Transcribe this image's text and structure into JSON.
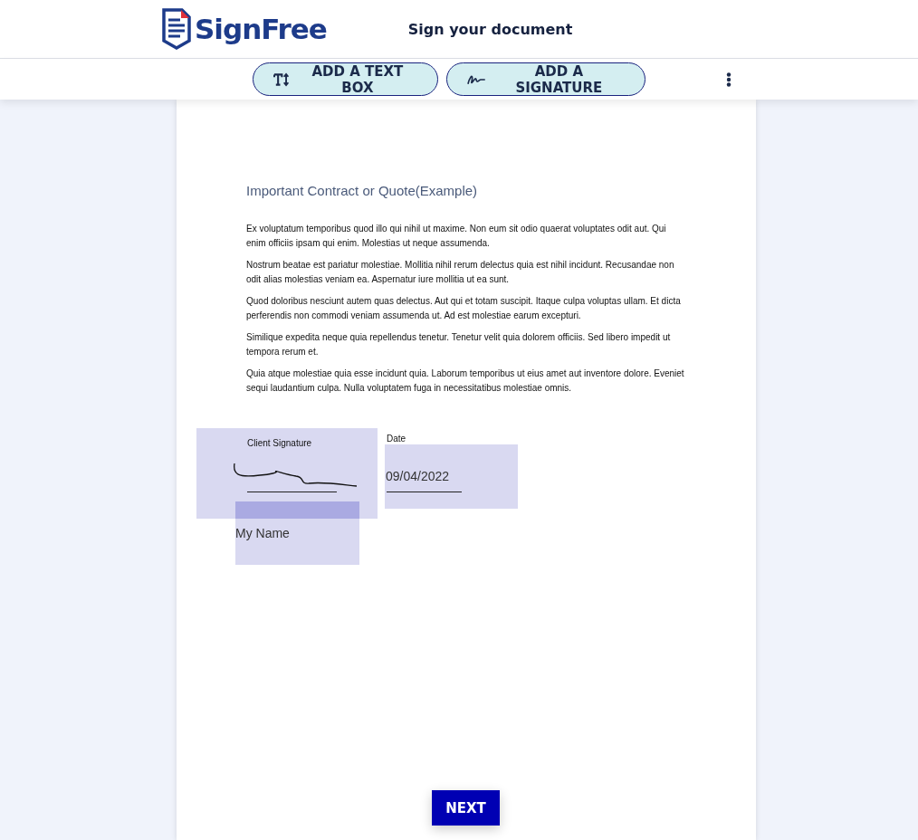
{
  "header": {
    "logo": "SignFree",
    "title": "Sign your document"
  },
  "toolbar": {
    "buttons": [
      {
        "label": "ADD A TEXT BOX",
        "kind": "text"
      },
      {
        "label": "ADD A SIGNATURE",
        "kind": "signature"
      }
    ]
  },
  "document": {
    "title": "Important Contract or Quote(Example)",
    "paragraphs": [
      "Ex voluptatum temporibus quod illo qui nihil ut maxime. Non eum sit odio quaerat voluptates odit aut. Qui enim officiis ipsam qui enim. Molestias ut neque assumenda.",
      "Nostrum beatae est pariatur molestiae. Mollitia nihil rerum delectus quia est nihil incidunt. Recusandae non odit alias molestias veniam ea. Aspernatur iure mollitia ut ea sunt.",
      "Quod doloribus nesciunt autem quas delectus. Aut qui et totam suscipit. Itaque culpa voluptas ullam. Et dicta perferendis non commodi veniam assumenda ut. Ad est molestiae earum excepturi.",
      "Similique expedita neque quia repellendus tenetur. Tenetur velit quia dolorem officiis. Sed libero impedit ut tempora rerum et.",
      "Quia atque molestiae quia esse incidunt quia. Laborum temporibus ut eius amet aut inventore dolore. Eveniet sequi laudantium culpa. Nulla voluptatem fuga in necessitatibus molestiae omnis."
    ],
    "signature_label": "Client Signature",
    "date_label": "Date",
    "date_value": "09/04/2022",
    "name_value": "My Name"
  },
  "next_button": "NEXT"
}
